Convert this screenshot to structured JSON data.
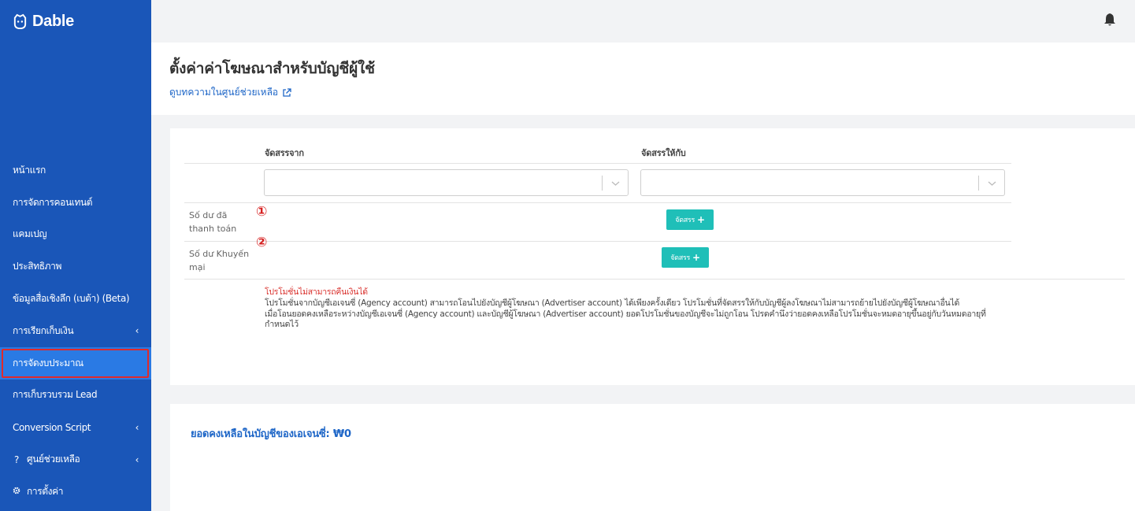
{
  "app": {
    "logo_text": "Dable"
  },
  "sidebar": {
    "items": [
      {
        "label": "หน้าแรก",
        "has_chevron": false
      },
      {
        "label": "การจัดการคอนเทนต์",
        "has_chevron": false
      },
      {
        "label": "แคมเปญ",
        "has_chevron": false
      },
      {
        "label": "ประสิทธิภาพ",
        "has_chevron": false
      },
      {
        "label": "ข้อมูลสื่อเชิงลึก (เบต้า) (Beta)",
        "has_chevron": false
      },
      {
        "label": "การเรียกเก็บเงิน",
        "has_chevron": true
      },
      {
        "label": "การจัดงบประมาณ",
        "has_chevron": false,
        "active": true
      },
      {
        "label": "การเก็บรวบรวม Lead",
        "has_chevron": false
      },
      {
        "label": "Conversion Script",
        "has_chevron": true
      },
      {
        "label": "ศูนย์ช่วยเหลือ",
        "has_chevron": true,
        "prefix": "?"
      },
      {
        "label": "การตั้งค่า",
        "has_chevron": false,
        "prefix": "gear-icon"
      }
    ],
    "chevron": "‹"
  },
  "topbar": {
    "icon": "bell-icon"
  },
  "header": {
    "title": "ตั้งค่าค่าโฆษณาสำหรับบัญชีผู้ใช้",
    "help_link": "ดูบทความในศูนย์ช่วยเหลือ"
  },
  "allocation": {
    "col_from": "จัดสรรจาก",
    "col_to": "จัดสรรให้กับ",
    "from_select": {
      "value": ""
    },
    "to_select": {
      "value": ""
    },
    "rows": [
      {
        "label": "Số dư đã thanh toán",
        "marker": "①",
        "button": "จัดสรร"
      },
      {
        "label": "Số dư Khuyến mại",
        "marker": "②",
        "button": "จัดสรร"
      }
    ],
    "plus": "+",
    "notes": {
      "warning": "โปรโมชั่นไม่สามารถคืนเงินได้",
      "line1": "โปรโมชั่นจากบัญชีเอเจนซี่ (Agency account) สามารถโอนไปยังบัญชีผู้โฆษณา (Advertiser account) ได้เพียงครั้งเดียว โปรโมชั่นที่จัดสรรให้กับบัญชีผู้ลงโฆษณาไม่สามารถย้ายไปยังบัญชีผู้โฆษณาอื่นได้",
      "line2": "เมื่อโอนยอดคงเหลือระหว่างบัญชีเอเจนซี่ (Agency account) และบัญชีผู้โฆษณา (Advertiser account) ยอดโปรโมชั่นของบัญชีจะไม่ถูกโอน โปรดคำนึงว่ายอดคงเหลือโปรโมชั่นจะหมดอายุขึ้นอยู่กับวันหมดอายุที่กำหนดไว้"
    }
  },
  "balance": {
    "label": "ยอดคงเหลือในบัญชีของเอเจนซี่: ₩0"
  },
  "colors": {
    "sidebar": "#1a56b8",
    "active": "#2a7ae4",
    "accent_button": "#1fbfb8",
    "link": "#1e66c7",
    "highlight": "#e02a2a"
  }
}
